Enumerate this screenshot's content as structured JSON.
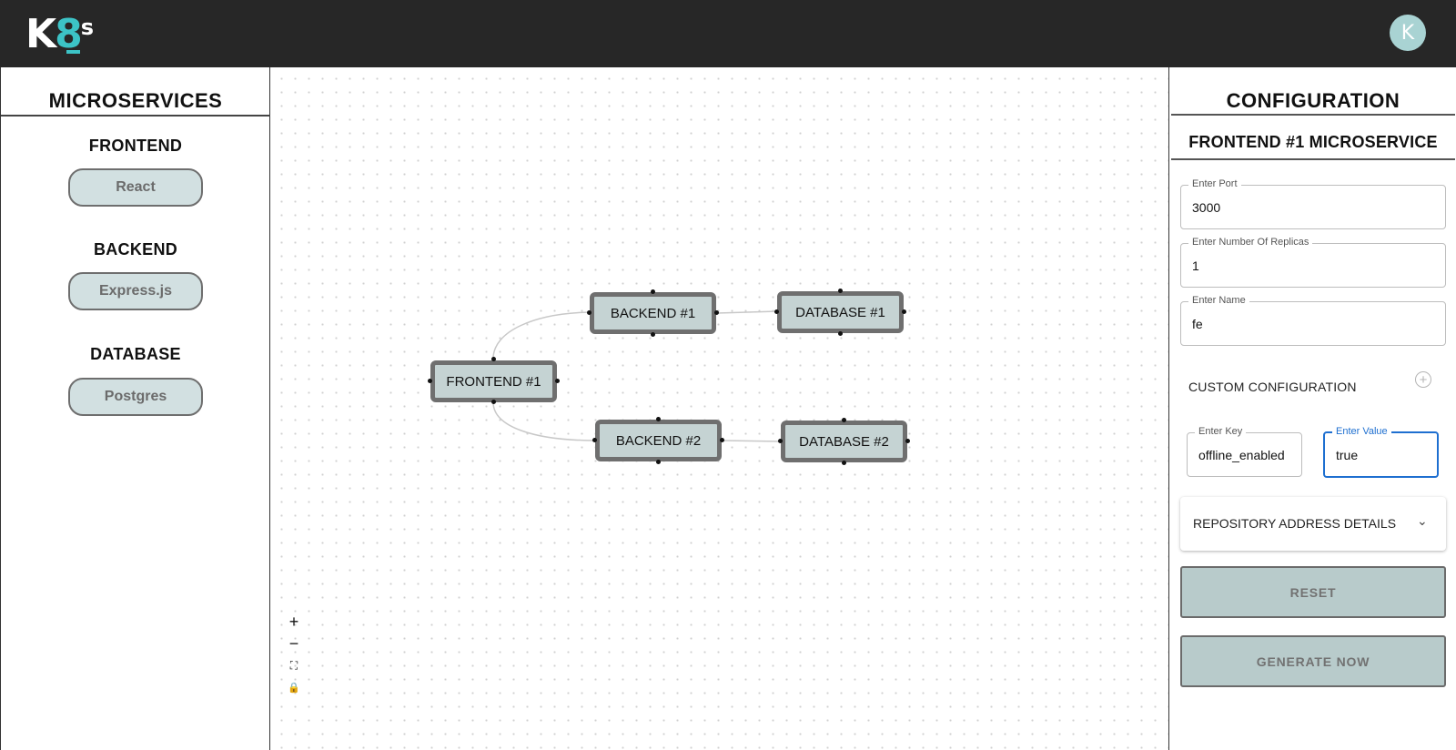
{
  "app": {
    "logo_k": "K",
    "logo_8": "8",
    "logo_s": "s",
    "user_initial": "K"
  },
  "left": {
    "title": "MICROSERVICES",
    "sections": [
      {
        "label": "FRONTEND",
        "item": "React"
      },
      {
        "label": "BACKEND",
        "item": "Express.js"
      },
      {
        "label": "DATABASE",
        "item": "Postgres"
      }
    ]
  },
  "canvas": {
    "nodes": {
      "frontend1": "FRONTEND #1",
      "backend1": "BACKEND #1",
      "backend2": "BACKEND #2",
      "database1": "DATABASE #1",
      "database2": "DATABASE #2"
    },
    "controls": {
      "zoom_in": "+",
      "zoom_out": "−",
      "fit": "⛶",
      "lock": "🔒"
    }
  },
  "right": {
    "title": "CONFIGURATION",
    "subtitle": "FRONTEND #1 MICROSERVICE",
    "port": {
      "label": "Enter Port",
      "value": "3000"
    },
    "replicas": {
      "label": "Enter Number Of Replicas",
      "value": "1"
    },
    "name": {
      "label": "Enter Name",
      "value": "fe"
    },
    "custom_label": "CUSTOM CONFIGURATION",
    "key": {
      "label": "Enter Key",
      "value": "offline_enabled"
    },
    "value": {
      "label": "Enter Value",
      "value": "true"
    },
    "repo_label": "REPOSITORY ADDRESS DETAILS",
    "reset_label": "RESET",
    "generate_label": "GENERATE NOW"
  }
}
